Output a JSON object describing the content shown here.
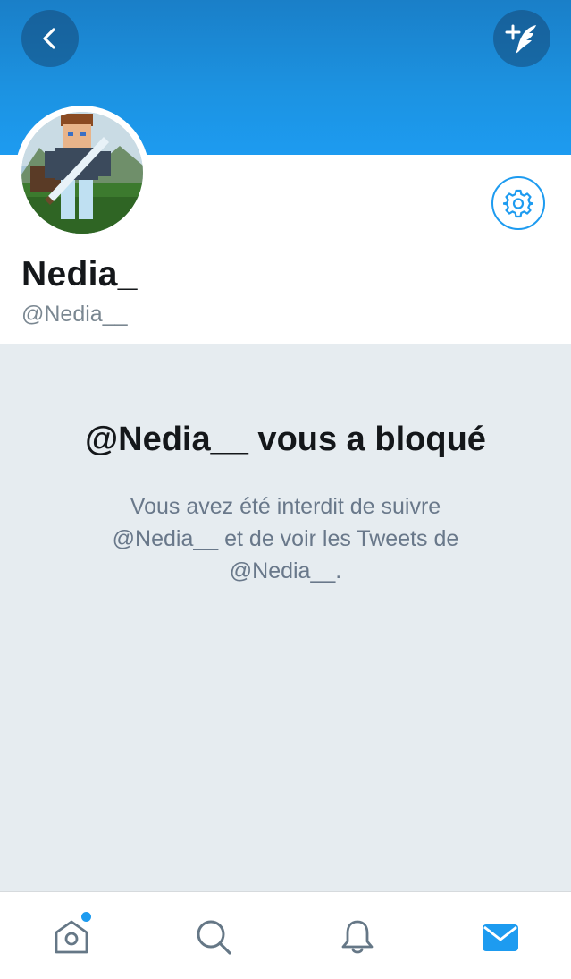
{
  "header": {
    "back_icon": "chevron-left-icon",
    "compose_icon": "compose-tweet-icon"
  },
  "profile": {
    "display_name": "Nedia_",
    "handle": "@Nedia__",
    "avatar_icon": "avatar-image",
    "settings_icon": "gear-icon"
  },
  "blocked": {
    "title": "@Nedia__ vous a bloqué",
    "message": "Vous avez été interdit de suivre @Nedia__ et de voir les Tweets de @Nedia__."
  },
  "tabbar": {
    "items": [
      {
        "name": "home",
        "icon": "home-icon",
        "active": false,
        "badge": true
      },
      {
        "name": "search",
        "icon": "search-icon",
        "active": false,
        "badge": false
      },
      {
        "name": "notifications",
        "icon": "bell-icon",
        "active": false,
        "badge": false
      },
      {
        "name": "messages",
        "icon": "envelope-icon",
        "active": true,
        "badge": false
      }
    ]
  },
  "colors": {
    "accent": "#1d9bf0",
    "banner_top": "#1a7fc8",
    "background": "#e6ecf0",
    "text_primary": "#14171a",
    "text_secondary": "#69788a",
    "icon_inactive": "#657786"
  }
}
